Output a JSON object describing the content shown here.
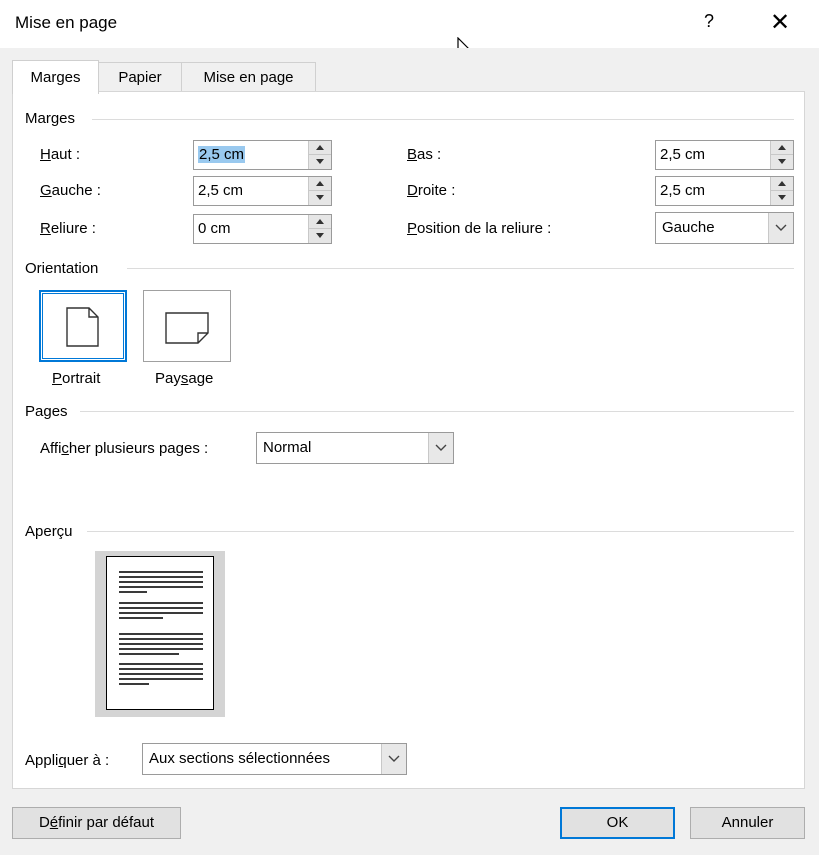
{
  "window": {
    "title": "Mise en page",
    "help_label": "?",
    "close_label": "✕"
  },
  "tabs": [
    {
      "label": "Marges",
      "active": true
    },
    {
      "label": "Papier",
      "active": false
    },
    {
      "label": "Mise en page",
      "active": false
    }
  ],
  "margins": {
    "group_label": "Marges",
    "top": {
      "label_u": "H",
      "label_rest": "aut :",
      "value": "2,5 cm"
    },
    "bottom": {
      "label_u": "B",
      "label_rest": "as :",
      "value": "2,5 cm"
    },
    "left": {
      "label_u": "G",
      "label_rest": "auche :",
      "value": "2,5 cm"
    },
    "right": {
      "label_u": "D",
      "label_rest": "roite :",
      "value": "2,5 cm"
    },
    "gutter": {
      "label_u": "R",
      "label_rest": "eliure :",
      "value": "0 cm"
    },
    "gutter_position": {
      "label_u": "P",
      "label_rest": "osition de la reliure :",
      "value": "Gauche"
    }
  },
  "orientation": {
    "group_label": "Orientation",
    "portrait": {
      "label_u": "P",
      "label_rest": "ortrait"
    },
    "landscape": {
      "label_pre": "Pay",
      "label_u": "s",
      "label_rest": "age"
    }
  },
  "pages": {
    "group_label": "Pages",
    "multiple_label_pre": "Affi",
    "multiple_label_u": "c",
    "multiple_label_rest": "her plusieurs pages :",
    "multiple_value": "Normal"
  },
  "preview": {
    "group_label": "Aperçu"
  },
  "apply": {
    "label_pre": "Appli",
    "label_u": "q",
    "label_rest": "uer à :",
    "value": "Aux sections sélectionnées"
  },
  "footer": {
    "default_pre": "D",
    "default_u": "é",
    "default_rest": "finir par défaut",
    "ok_label": "OK",
    "cancel_label": "Annuler"
  }
}
